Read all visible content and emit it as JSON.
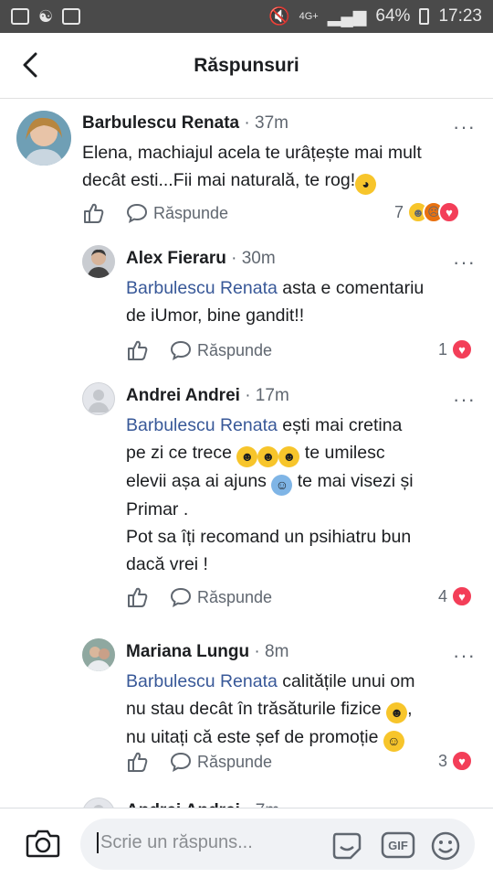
{
  "status_bar": {
    "network": "4G+",
    "battery": "64%",
    "time": "17:23"
  },
  "header": {
    "title": "Răspunsuri"
  },
  "actions": {
    "reply_label": "Răspunde"
  },
  "comments": [
    {
      "author": "Barbulescu Renata",
      "time": "· 37m",
      "lines": [
        "Elena, machiajul acela te urâțește mai mult",
        "decât esti...Fii mai naturală, te rog!"
      ],
      "reaction_count": "7",
      "reactions": [
        "haha-icon",
        "angry-icon",
        "love-icon"
      ]
    },
    {
      "author": "Alex Fieraru",
      "time": "· 30m",
      "mention": "Barbulescu Renata",
      "lines": [
        " asta e comentariu",
        "de iUmor, bine gandit!!"
      ],
      "reaction_count": "1",
      "reactions": [
        "love-icon"
      ]
    },
    {
      "author": "Andrei Andrei",
      "time": "· 17m",
      "mention": "Barbulescu Renata",
      "lines": [
        "  ești mai cretina",
        "pe zi ce trece ",
        " te umilesc",
        "elevii așa ai ajuns ",
        " te mai visezi și",
        "Primar .",
        "Pot sa îți recomand un psihiatru bun",
        "dacă vrei !"
      ],
      "reaction_count": "4",
      "reactions": [
        "love-icon"
      ]
    },
    {
      "author": "Mariana Lungu",
      "time": "· 8m",
      "mention": "Barbulescu Renata",
      "lines": [
        " calitățile unui om",
        "nu stau decât în trăsăturile fizice ",
        ",",
        "nu uitați că este șef de promoție "
      ],
      "reaction_count": "3",
      "reactions": [
        "love-icon"
      ]
    },
    {
      "author": "Andrei Andrei",
      "time": "· 7m"
    }
  ],
  "composer": {
    "placeholder": "Scrie un răspuns..."
  },
  "colors": {
    "mention": "#385898",
    "love": "#f33e58",
    "haha": "#f7c52b",
    "angry": "#e9710f",
    "statusbar": "#4a4a4a"
  }
}
